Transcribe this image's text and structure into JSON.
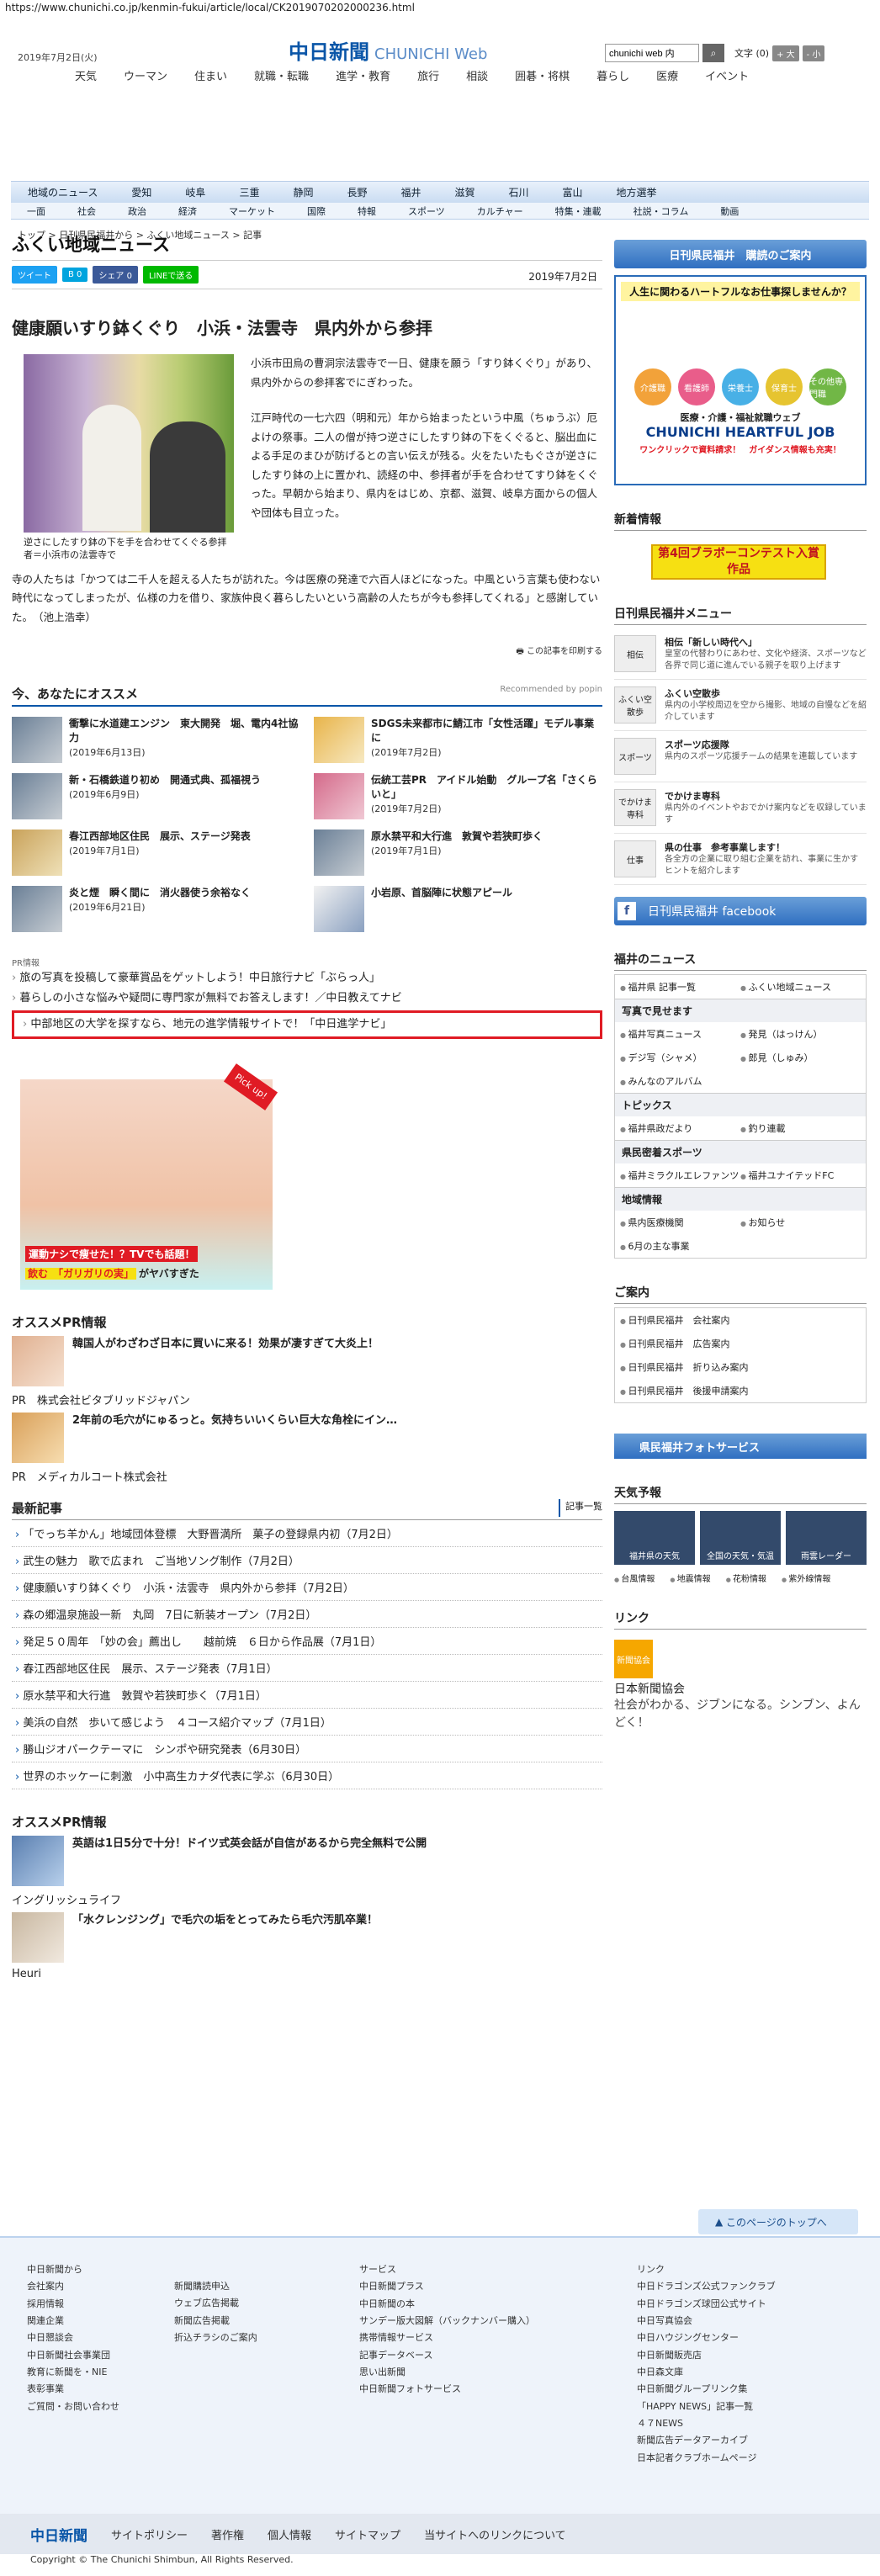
{
  "url": "https://www.chunichi.co.jp/kenmin-fukui/article/local/CK2019070202000236.html",
  "header": {
    "date": "2019年7月2日(火)",
    "logo": "中日新聞",
    "logo_web": "CHUNICHI Web",
    "search_value": "chunichi web 内",
    "text_label": "文字",
    "text_count": "(0)",
    "bigger": "+ 大",
    "smaller": "- 小"
  },
  "topnav": [
    "天気",
    "ウーマン",
    "住まい",
    "就職・転職",
    "進学・教育",
    "旅行",
    "相談",
    "囲碁・将棋",
    "暮らし",
    "医療",
    "イベント"
  ],
  "navbar": [
    "地域のニュース",
    "愛知",
    "岐阜",
    "三重",
    "静岡",
    "長野",
    "福井",
    "滋賀",
    "石川",
    "富山",
    "地方選挙"
  ],
  "navbar2": [
    "一面",
    "社会",
    "政治",
    "経済",
    "マーケット",
    "国際",
    "特報",
    "スポーツ",
    "カルチャー",
    "特集・連載",
    "社説・コラム",
    "動画"
  ],
  "breadcrumb": "トップ > 日刊県民福井から > ふくい地域ニュース > 記事",
  "section_title": "ふくい地域ニュース",
  "share": {
    "tweet": "ツイート",
    "hatena": "B 0",
    "fb_share": "シェア 0",
    "line": "LINEで送る",
    "date": "2019年7月2日"
  },
  "article": {
    "headline": "健康願いすり鉢くぐり　小浜・法雲寺　県内外から参拝",
    "caption": "逆さにしたすり鉢の下を手を合わせてくぐる参拝者＝小浜市の法雲寺で",
    "p1": "小浜市田烏の曹洞宗法雲寺で一日、健康を願う「すり鉢くぐり」があり、県内外からの参拝客でにぎわった。",
    "p2": "江戸時代の一七六四（明和元）年から始まったという中風（ちゅうぶ）厄よけの祭事。二人の僧が持つ逆さにしたすり鉢の下をくぐると、脳出血による手足のまひが防げるとの言い伝えが残る。火をたいたもぐさが逆さにしたすり鉢の上に置かれ、読経の中、参拝者が手を合わせてすり鉢をくぐった。早朝から始まり、県内をはじめ、京都、滋賀、岐阜方面からの個人や団体も目立った。",
    "p3": "寺の人たちは「かつては二千人を超える人たちが訪れた。今は医療の発達で六百人ほどになった。中風という言葉も使わない時代になってしまったが、仏様の力を借り、家族仲良く暮らしたいという高齢の人たちが今も参拝してくれる」と感謝していた。　（池上浩幸）",
    "print": "この記事を印刷する"
  },
  "reco": {
    "title": "今、あなたにオススメ",
    "powered": "Recommended by popin",
    "items": [
      {
        "t": "衝撃に水道建エンジン　東大開発　堀、電内4社協力",
        "d": "(2019年6月13日)"
      },
      {
        "t": "SDGS未来都市に鯖江市「女性活躍」モデル事業に",
        "d": "(2019年7月2日)"
      },
      {
        "t": "新・石橋鉄道り初め　開通式典、孤福視う",
        "d": "(2019年6月9日)"
      },
      {
        "t": "伝統工芸PR　アイドル始動　グループ名「さくらいと」",
        "d": "(2019年7月2日)"
      },
      {
        "t": "春江西部地区住民　展示、ステージ発表",
        "d": "(2019年7月1日)"
      },
      {
        "t": "原水禁平和大行進　敦賀や若狭町歩く",
        "d": "(2019年7月1日)"
      },
      {
        "t": "炎と煙　瞬く間に　消火器使う余裕なく",
        "d": "(2019年6月21日)"
      },
      {
        "t": "小岩原、首脳陣に状態アピール",
        "d": ""
      }
    ]
  },
  "pr": {
    "label": "PR情報",
    "items": [
      "旅の写真を投稿して豪華賞品をゲットしよう！中日旅行ナビ「ぶらっ人」",
      "暮らしの小さな悩みや疑問に専門家が無料でお答えします！／中日教えてナビ"
    ],
    "highlight": "中部地区の大学を探すなら、地元の進学情報サイトで！「中日進学ナビ」"
  },
  "ad": {
    "pick": "Pick up!",
    "b1": "運動ナシで痩せた！？TVでも話題！",
    "b2a": "飲む",
    "b2b": "「ガリガリの実」",
    "b2c": "がヤバすぎた"
  },
  "osusume1": {
    "title": "オススメPR情報",
    "items": [
      {
        "t": "韓国人がわざわざ日本に買いに来る！効果が凄すぎて大炎上！",
        "src": "PR　株式会社ビタブリッドジャパン"
      },
      {
        "t": "2年前の毛穴がにゅるっと。気持ちいいくらい巨大な角栓にイン…",
        "src": "PR　メディカルコート株式会社"
      }
    ]
  },
  "latest": {
    "title": "最新記事",
    "all": "記事一覧",
    "items": [
      "「でっち羊かん」地域団体登標　大野晋満所　菓子の登録県内初（7月2日）",
      "武生の魅力　歌で広まれ　ご当地ソング制作（7月2日）",
      "健康願いすり鉢くぐり　小浜・法雲寺　県内外から参拝（7月2日）",
      "森の郷温泉施設一新　丸岡　7日に新装オープン（7月2日）",
      "発足５０周年　「妙の会」薦出し　　越前焼　６日から作品展（7月1日）",
      "春江西部地区住民　展示、ステージ発表（7月1日）",
      "原水禁平和大行進　敦賀や若狭町歩く（7月1日）",
      "美浜の自然　歩いて感じよう　４コース紹介マップ（7月1日）",
      "勝山ジオパークテーマに　シンポや研究発表（6月30日）",
      "世界のホッケーに刺激　小中高生カナダ代表に学ぶ（6月30日）"
    ]
  },
  "osusume2": {
    "title": "オススメPR情報",
    "items": [
      {
        "t": "英語は1日5分で十分！ドイツ式英会話が自信があるから完全無料で公開",
        "src": "イングリッシュライフ"
      },
      {
        "t": "「水クレンジング」で毛穴の垢をとってみたら毛穴汚肌卒業！",
        "src": "Heuri"
      }
    ]
  },
  "side": {
    "kodoku": "日刊県民福井　購読のご案内",
    "job": {
      "l1": "人生に関わるハートフルなお仕事探しませんか？",
      "c": [
        "介護職",
        "看護師",
        "栄養士",
        "保育士",
        "その他専門職"
      ],
      "l2": "医療・介護・福祉就職ウェブ",
      "l3": "CHUNICHI HEARTFUL JOB",
      "l4": "ワンクリックで資料請求！　ガイダンス情報も充実！"
    },
    "new_title": "新着情報",
    "contest": "第4回ブラボーコンテスト入賞作品",
    "menu_title": "日刊県民福井メニュー",
    "menu": [
      {
        "ic": "相伝",
        "h": "相伝「新しい時代へ」",
        "b": "皇室の代替わりにあわせ、文化や経済、スポーツなど各界で同じ道に進んでいる親子を取り上げます"
      },
      {
        "ic": "ふくい空散歩",
        "h": "ふくい空散歩",
        "b": "県内の小学校周辺を空から撮影、地域の自慢などを紹介しています"
      },
      {
        "ic": "スポーツ",
        "h": "スポーツ応援隊",
        "b": "県内のスポーツ応援チームの結果を連載しています"
      },
      {
        "ic": "でかけま専科",
        "h": "でかけま専科",
        "b": "県内外のイベントやおでかけ案内などを収録しています"
      },
      {
        "ic": "仕事",
        "h": "県の仕事　参考事業します！",
        "b": "各全方の企業に取り組む企業を訪れ、事業に生かすヒントを紹介します"
      }
    ],
    "facebook": "日刊県民福井 facebook",
    "fukui_title": "福井のニュース",
    "fukui": [
      [
        "福井県 記事一覧",
        "ふくい地域ニュース"
      ]
    ],
    "kiji_sub": "写真で見せます",
    "kiji": [
      [
        "福井写真ニュース",
        "発見（はっけん）"
      ],
      [
        "デジ写（シャメ）",
        "郎見（しゅみ）"
      ],
      [
        "みんなのアルバム",
        ""
      ]
    ],
    "topics_sub": "トピックス",
    "topics": [
      [
        "福井県政だより",
        "釣り連載"
      ]
    ],
    "sports_sub": "県民密着スポーツ",
    "sports": [
      [
        "福井ミラクルエレファンツ",
        "福井ユナイテッドFC"
      ]
    ],
    "area_sub": "地域情報",
    "area": [
      [
        "県内医療機関",
        "お知らせ"
      ],
      [
        "6月の主な事業",
        ""
      ]
    ],
    "guide_title": "ご案内",
    "guide": [
      "日刊県民福井　会社案内",
      "日刊県民福井　広告案内",
      "日刊県民福井　折り込み案内",
      "日刊県民福井　後援申請案内"
    ],
    "photoservice": "県民福井フォトサービス",
    "weather_title": "天気予報",
    "weather": [
      "福井県の天気",
      "全国の天気・気温",
      "雨雲レーダー"
    ],
    "wrow": [
      "台風情報",
      "地震情報",
      "花粉情報",
      "紫外線情報"
    ],
    "link_title": "リンク",
    "link_icon": "新聞協会",
    "link_name": "日本新聞協会",
    "link_slogan": "社会がわかる、ジブンになる。シンブン、よんどく！"
  },
  "totop": "このページのトップへ",
  "footer": {
    "c1_title": "中日新聞から",
    "c1": [
      "会社案内",
      "採用情報",
      "関連企業",
      "中日懇談会",
      "中日新聞社会事業団",
      "教育に新聞を・NIE",
      "表彰事業",
      "ご質問・お問い合わせ"
    ],
    "c2": [
      "新聞購読申込",
      "ウェブ広告掲載",
      "新聞広告掲載",
      "折込チラシのご案内"
    ],
    "c3_title": "サービス",
    "c3": [
      "中日新聞プラス",
      "中日新聞の本",
      "サンデー版大図解（バックナンバー購入）",
      "携帯情報サービス",
      "記事データベース",
      "思い出新聞",
      "中日新聞フォトサービス"
    ],
    "c4_title": "リンク",
    "c4": [
      "中日ドラゴンズ公式ファンクラブ",
      "中日ドラゴンズ球団公式サイト",
      "中日写真協会",
      "中日ハウジングセンター",
      "中日新聞販売店",
      "中日森文庫",
      "中日新聞グループリンク集",
      "「HAPPY NEWS」記事一覧",
      "４７NEWS",
      "新聞広告データアーカイブ",
      "日本記者クラブホームページ"
    ],
    "bar": [
      "中日新聞",
      "サイトポリシー",
      "著作権",
      "個人情報",
      "サイトマップ",
      "当サイトへのリンクについて"
    ],
    "copy": "Copyright © The Chunichi Shimbun, All Rights Reserved."
  }
}
